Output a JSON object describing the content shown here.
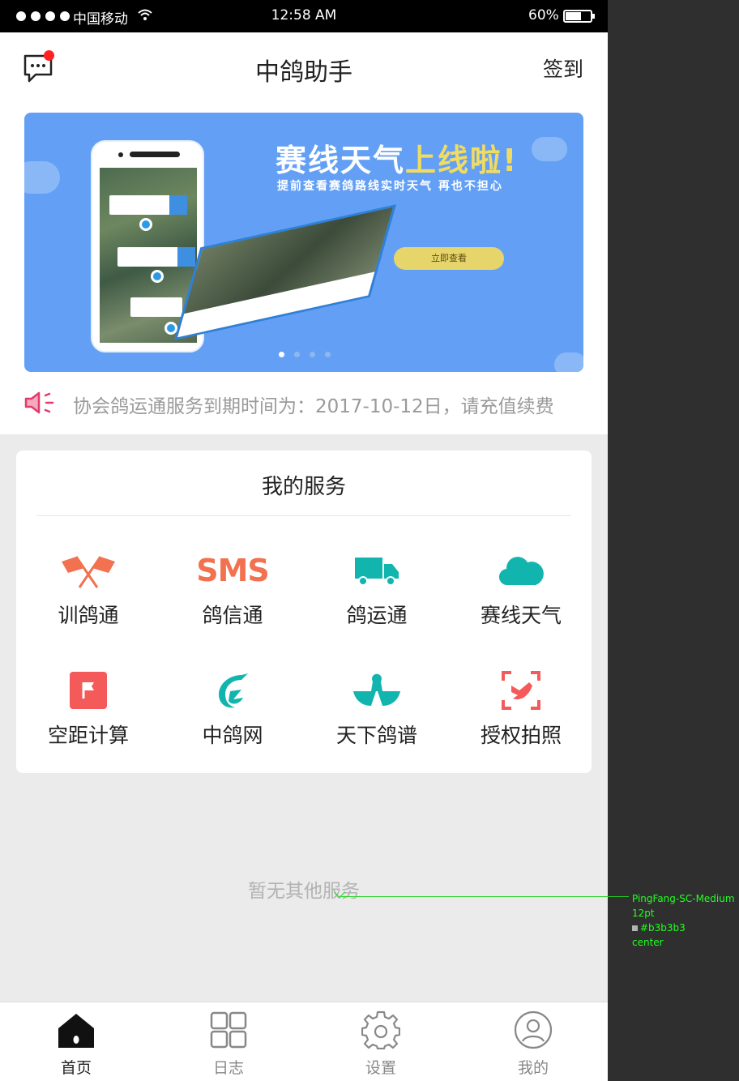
{
  "status_bar": {
    "carrier": "中国移动",
    "time": "12:58  AM",
    "battery": "60%"
  },
  "header": {
    "title": "中鸽助手",
    "signin": "签到"
  },
  "banner": {
    "headline_main": "赛线天气",
    "headline_highlight": "上线啦!",
    "subline": "提前查看赛鸽路线实时天气  再也不担心",
    "cta": "立即查看",
    "slides": 4,
    "active_slide": 1
  },
  "notice": {
    "text": "协会鸽运通服务到期时间为：2017-10-12日，请充值续费"
  },
  "services": {
    "title": "我的服务",
    "items": [
      {
        "label": "训鸽通",
        "icon": "crossed-flags-icon",
        "color": "#f2714f"
      },
      {
        "label": "鸽信通",
        "icon": "sms-icon",
        "color": "#f2714f"
      },
      {
        "label": "鸽运通",
        "icon": "truck-icon",
        "color": "#12b5ae"
      },
      {
        "label": "赛线天气",
        "icon": "cloud-icon",
        "color": "#12b5ae"
      },
      {
        "label": "空距计算",
        "icon": "flag-icon",
        "color": "#f55a5a"
      },
      {
        "label": "中鸽网",
        "icon": "pigeon-logo-icon",
        "color": "#12b5ae"
      },
      {
        "label": "天下鸽谱",
        "icon": "bird-hands-icon",
        "color": "#12b5ae"
      },
      {
        "label": "授权拍照",
        "icon": "scan-bird-icon",
        "color": "#f55a5a"
      }
    ]
  },
  "empty_text": "暂无其他服务",
  "tabbar": {
    "tabs": [
      {
        "label": "首页",
        "icon": "home-icon",
        "active": true
      },
      {
        "label": "日志",
        "icon": "grid-icon",
        "active": false
      },
      {
        "label": "设置",
        "icon": "gear-icon",
        "active": false
      },
      {
        "label": "我的",
        "icon": "user-icon",
        "active": false
      }
    ]
  },
  "annotation": {
    "font": "PingFang-SC-Medium",
    "size": "12pt",
    "color": "#b3b3b3",
    "align": "center"
  }
}
